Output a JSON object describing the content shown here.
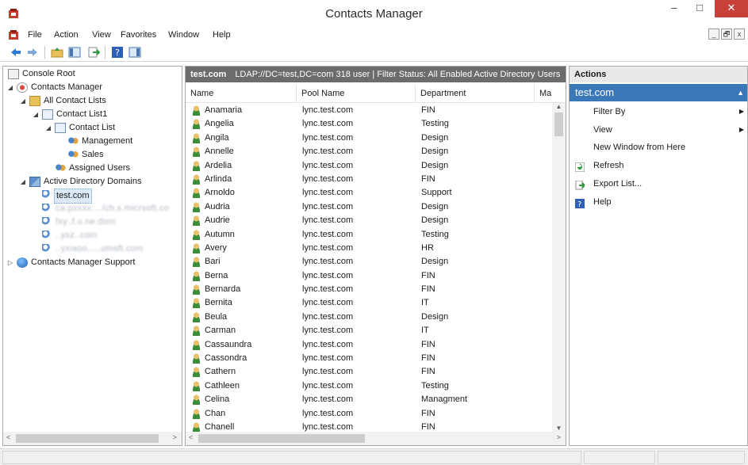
{
  "window": {
    "title": "Contacts Manager",
    "min_glyph": "–",
    "max_glyph": "□",
    "close_glyph": "✕"
  },
  "menu": [
    "File",
    "Action",
    "View",
    "Favorites",
    "Window",
    "Help"
  ],
  "mdi_buttons": [
    "_",
    "🗗",
    "x"
  ],
  "toolbar_icons": [
    "back-icon",
    "forward-icon",
    "up-folder-icon",
    "show-hide-tree-icon",
    "export-list-icon",
    "help-icon",
    "show-action-pane-icon"
  ],
  "tree": {
    "root": "Console Root",
    "cm": "Contacts Manager",
    "all_lists": "All Contact Lists",
    "list1": "Contact List1",
    "contact_list": "Contact List",
    "management": "Management",
    "sales": "Sales",
    "assigned": "Assigned Users",
    "ad_domains": "Active Directory Domains",
    "domain_selected": "test.com",
    "blurred": [
      "ca.pxxxx..../ch.s.micrsoft.co",
      "fxy..f.u.ne.dom",
      "..ysz..com",
      "..yxiaoo.....umsft.com"
    ],
    "support": "Contacts Manager Support"
  },
  "list": {
    "domain": "test.com",
    "header_info": "LDAP://DC=test,DC=com 318 user  |  Filter Status: All Enabled Active Directory Users",
    "columns": [
      "Name",
      "Pool Name",
      "Department",
      "Ma"
    ],
    "rows": [
      [
        "Anamaria",
        "lync.test.com",
        "FIN"
      ],
      [
        "Angelia",
        "lync.test.com",
        "Testing"
      ],
      [
        "Angila",
        "lync.test.com",
        "Design"
      ],
      [
        "Annelle",
        "lync.test.com",
        "Design"
      ],
      [
        "Ardelia",
        "lync.test.com",
        "Design"
      ],
      [
        "Arlinda",
        "lync.test.com",
        "FIN"
      ],
      [
        "Arnoldo",
        "lync.test.com",
        "Support"
      ],
      [
        "Audria",
        "lync.test.com",
        "Design"
      ],
      [
        "Audrie",
        "lync.test.com",
        "Design"
      ],
      [
        "Autumn",
        "lync.test.com",
        "Testing"
      ],
      [
        "Avery",
        "lync.test.com",
        "HR"
      ],
      [
        "Bari",
        "lync.test.com",
        "Design"
      ],
      [
        "Berna",
        "lync.test.com",
        "FIN"
      ],
      [
        "Bernarda",
        "lync.test.com",
        "FIN"
      ],
      [
        "Bernita",
        "lync.test.com",
        "IT"
      ],
      [
        "Beula",
        "lync.test.com",
        "Design"
      ],
      [
        "Carman",
        "lync.test.com",
        "IT"
      ],
      [
        "Cassaundra",
        "lync.test.com",
        "FIN"
      ],
      [
        "Cassondra",
        "lync.test.com",
        "FIN"
      ],
      [
        "Cathern",
        "lync.test.com",
        "FIN"
      ],
      [
        "Cathleen",
        "lync.test.com",
        "Testing"
      ],
      [
        "Celina",
        "lync.test.com",
        "Managment"
      ],
      [
        "Chan",
        "lync.test.com",
        "FIN"
      ],
      [
        "Chanell",
        "lync.test.com",
        "FIN"
      ]
    ]
  },
  "actions": {
    "header": "Actions",
    "section": "test.com",
    "items": [
      "Filter By",
      "View",
      "New Window from Here",
      "Refresh",
      "Export List...",
      "Help"
    ]
  },
  "colors": {
    "accent": "#3b78b7",
    "header_strip": "#6c6c6c",
    "close": "#c7413a"
  }
}
